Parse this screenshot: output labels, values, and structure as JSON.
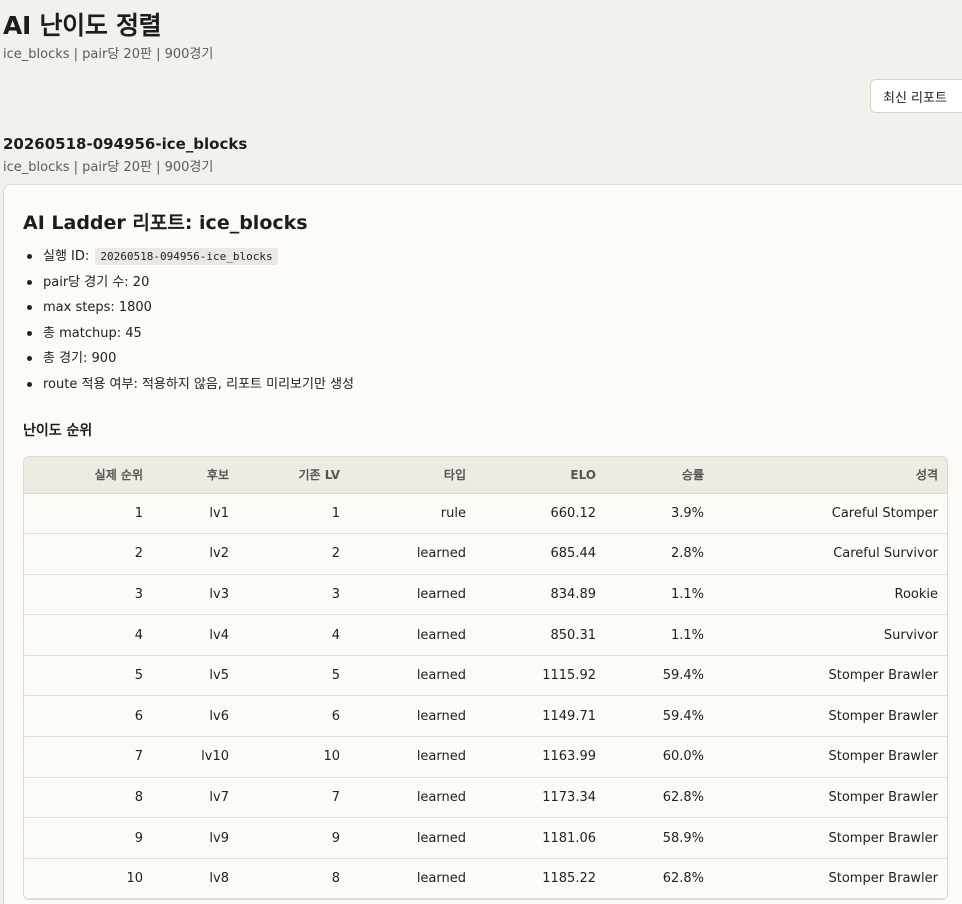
{
  "header": {
    "title": "AI 난이도 정렬",
    "subtitle": "ice_blocks | pair당 20판 | 900경기",
    "latest_button_label": "최신 리포트"
  },
  "run": {
    "title": "20260518-094956-ice_blocks",
    "subtitle": "ice_blocks | pair당 20판 | 900경기"
  },
  "report": {
    "title": "AI Ladder 리포트: ice_blocks",
    "meta": {
      "run_id_label": "실행 ID:",
      "run_id_value": "20260518-094956-ice_blocks",
      "games_per_pair": "pair당 경기 수: 20",
      "max_steps": "max steps: 1800",
      "total_matchups": "총 matchup: 45",
      "total_games": "총 경기: 900",
      "route_applied": "route 적용 여부: 적용하지 않음, 리포트 미리보기만 생성"
    },
    "ranking_heading": "난이도 순위",
    "table": {
      "columns": [
        "실제 순위",
        "후보",
        "기존 LV",
        "타입",
        "ELO",
        "승률",
        "성격"
      ],
      "rows": [
        [
          "1",
          "lv1",
          "1",
          "rule",
          "660.12",
          "3.9%",
          "Careful Stomper"
        ],
        [
          "2",
          "lv2",
          "2",
          "learned",
          "685.44",
          "2.8%",
          "Careful Survivor"
        ],
        [
          "3",
          "lv3",
          "3",
          "learned",
          "834.89",
          "1.1%",
          "Rookie"
        ],
        [
          "4",
          "lv4",
          "4",
          "learned",
          "850.31",
          "1.1%",
          "Survivor"
        ],
        [
          "5",
          "lv5",
          "5",
          "learned",
          "1115.92",
          "59.4%",
          "Stomper Brawler"
        ],
        [
          "6",
          "lv6",
          "6",
          "learned",
          "1149.71",
          "59.4%",
          "Stomper Brawler"
        ],
        [
          "7",
          "lv10",
          "10",
          "learned",
          "1163.99",
          "60.0%",
          "Stomper Brawler"
        ],
        [
          "8",
          "lv7",
          "7",
          "learned",
          "1173.34",
          "62.8%",
          "Stomper Brawler"
        ],
        [
          "9",
          "lv9",
          "9",
          "learned",
          "1181.06",
          "58.9%",
          "Stomper Brawler"
        ],
        [
          "10",
          "lv8",
          "8",
          "learned",
          "1185.22",
          "62.8%",
          "Stomper Brawler"
        ]
      ]
    }
  }
}
